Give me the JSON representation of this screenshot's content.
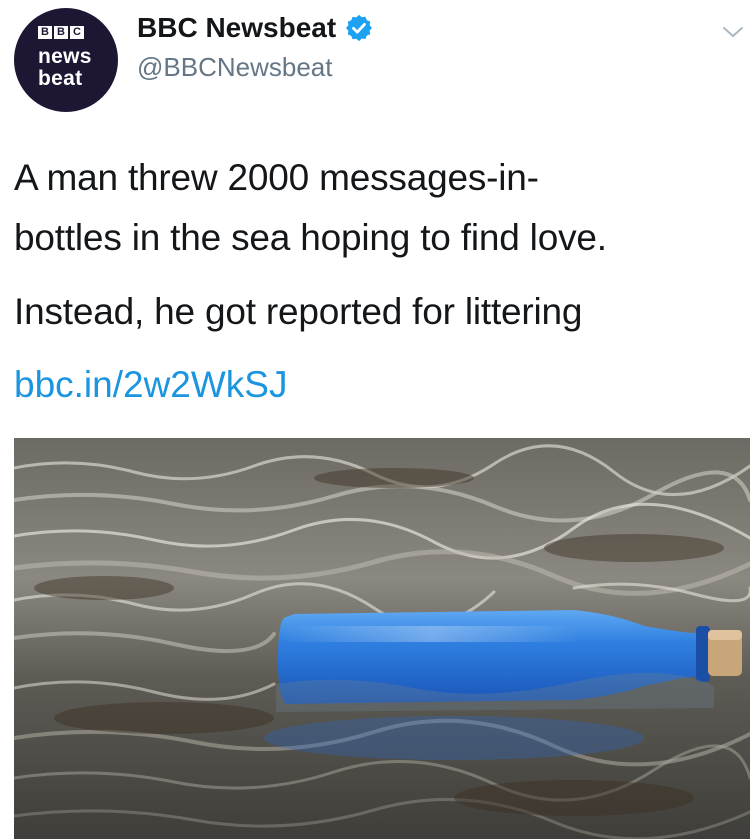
{
  "account": {
    "avatar_blocks": [
      "B",
      "B",
      "C"
    ],
    "avatar_line1": "news",
    "avatar_line2": "beat",
    "display_name": "BBC Newsbeat",
    "handle": "@BBCNewsbeat",
    "verified": true
  },
  "tweet": {
    "text_line1": "A man threw 2000 messages-in-",
    "text_line2": "bottles in the sea hoping to find love.",
    "text_line3": "Instead, he got reported for littering",
    "link": "bbc.in/2w2WkSJ"
  },
  "media": {
    "description_icon": "bottle-in-sea-photo"
  },
  "colors": {
    "link": "#1b95e0",
    "verified": "#1da1f2",
    "avatar_bg": "#1e1733",
    "handle": "#657786"
  }
}
